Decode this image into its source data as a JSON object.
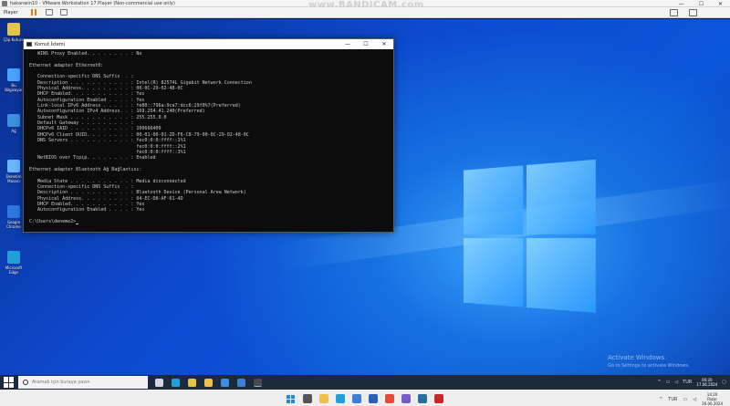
{
  "host": {
    "title": "hakanwin10 - VMware Workstation 17 Player (Non-commercial use only)",
    "player_menu": "Player",
    "minimize": "—",
    "maximize": "☐",
    "close": "✕"
  },
  "watermark": "www.BANDICAM.com",
  "desktop_icons": [
    {
      "label": "Çöp Kutusu",
      "color": "#e8c34a"
    },
    {
      "label": "Bu Bilgisayar",
      "color": "#4aa3ff"
    },
    {
      "label": "Ağ",
      "color": "#3d8fe0"
    },
    {
      "label": "Denetim Masası",
      "color": "#6cb6ff"
    },
    {
      "label": "Google Chrome",
      "color": "#2b79e0"
    },
    {
      "label": "Microsoft Edge",
      "color": "#1fa0d8"
    }
  ],
  "cmd": {
    "title": "Komut İstemi",
    "lines": [
      "   WINS Proxy Enabled. . . . . . . . : No",
      "",
      "Ethernet adapter Ethernet0:",
      "",
      "   Connection-specific DNS Suffix  . :",
      "   Description . . . . . . . . . . . : Intel(R) 82574L Gigabit Network Connection",
      "   Physical Address. . . . . . . . . : 00-0C-29-02-48-0C",
      "   DHCP Enabled. . . . . . . . . . . : Yes",
      "   Autoconfiguration Enabled . . . . : Yes",
      "   Link-local IPv6 Address . . . . . : fe80::796a:9ca7:dcc6:29f0%7(Preferred)",
      "   Autoconfiguration IPv4 Address. . : 169.254.41.240(Preferred)",
      "   Subnet Mask . . . . . . . . . . . : 255.255.0.0",
      "   Default Gateway . . . . . . . . . :",
      "   DHCPv6 IAID . . . . . . . . . . . : 100666409",
      "   DHCPv6 Client DUID. . . . . . . . : 00-01-00-01-2D-F6-C8-79-00-0C-29-02-48-0C",
      "   DNS Servers . . . . . . . . . . . : fec0:0:0:ffff::1%1",
      "                                       fec0:0:0:ffff::2%1",
      "                                       fec0:0:0:ffff::3%1",
      "   NetBIOS over Tcpip. . . . . . . . : Enabled",
      "",
      "Ethernet adapter Bluetooth Ağ Bağlantısı:",
      "",
      "   Media State . . . . . . . . . . . : Media disconnected",
      "   Connection-specific DNS Suffix  . :",
      "   Description . . . . . . . . . . . : Bluetooth Device (Personal Area Network)",
      "   Physical Address. . . . . . . . . : 04-EC-D8-AF-61-4D",
      "   DHCP Enabled. . . . . . . . . . . : Yes",
      "   Autoconfiguration Enabled . . . . : Yes",
      "",
      "C:\\Users\\deneme2>"
    ]
  },
  "activate": {
    "title": "Activate Windows",
    "subtitle": "Go to Settings to activate Windows."
  },
  "taskbar": {
    "search_placeholder": "Aramak için buraya yazın",
    "apps": [
      {
        "name": "task-view-icon",
        "color": "#cfd8e3"
      },
      {
        "name": "edge-icon",
        "color": "#1fa0d8"
      },
      {
        "name": "chrome-icon",
        "color": "#e8c34a"
      },
      {
        "name": "explorer-icon",
        "color": "#f0c04a"
      },
      {
        "name": "store-icon",
        "color": "#3a8ee6"
      },
      {
        "name": "mail-icon",
        "color": "#3b7fd6"
      },
      {
        "name": "cmd-icon",
        "color": "#4a4a4a"
      }
    ],
    "tray_lang": "TUR",
    "time": "00:20",
    "date": "17.06.2024"
  },
  "host_taskbar": {
    "apps": [
      {
        "name": "search-icon",
        "color": "#555555"
      },
      {
        "name": "explorer-icon",
        "color": "#f0c04a"
      },
      {
        "name": "edge-icon",
        "color": "#1fa0d8"
      },
      {
        "name": "mail-icon",
        "color": "#3b7fd6"
      },
      {
        "name": "word-icon",
        "color": "#2b5fb8"
      },
      {
        "name": "chrome-icon",
        "color": "#e44b3b"
      },
      {
        "name": "photos-icon",
        "color": "#7a5cc6"
      },
      {
        "name": "vmware-icon",
        "color": "#2a6e9e"
      },
      {
        "name": "bandicam-icon",
        "color": "#c62828"
      }
    ],
    "tray_lang": "TUR",
    "time": "14:20",
    "day": "Pazar",
    "date": "16.06.2024"
  }
}
